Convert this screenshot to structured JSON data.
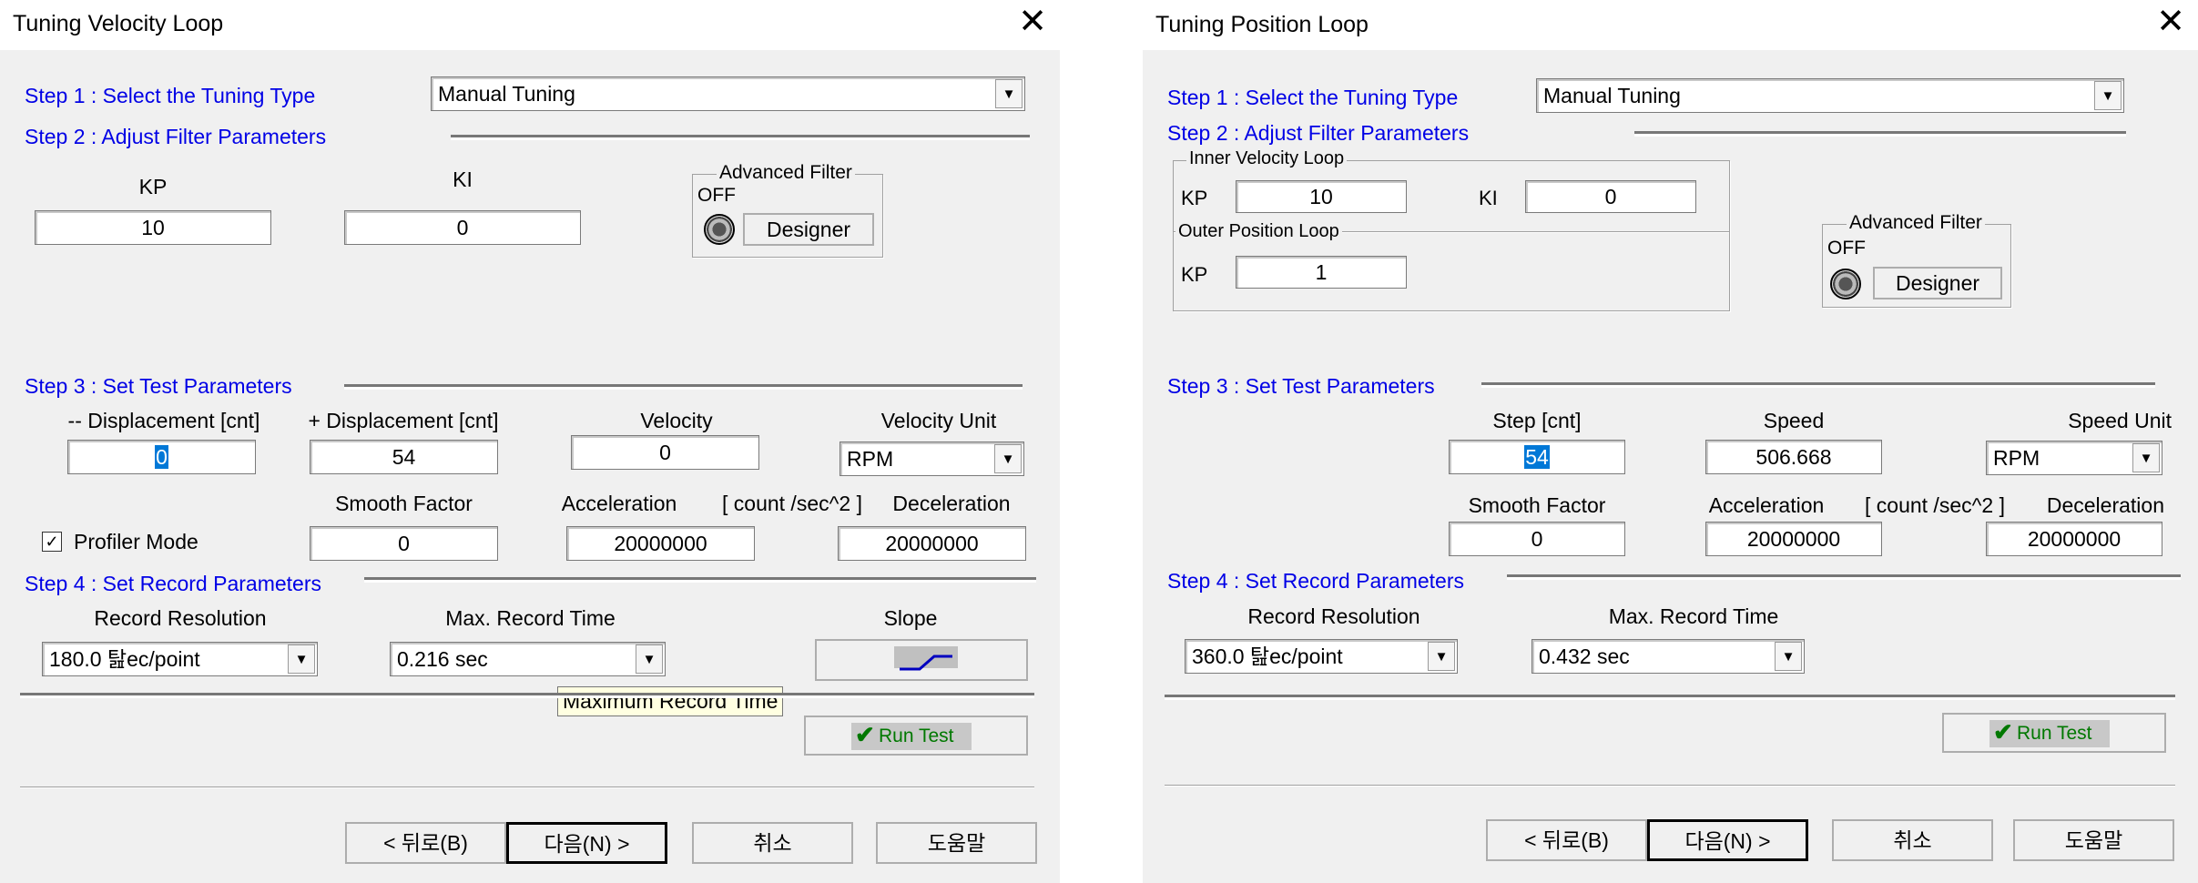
{
  "velocity_dialog": {
    "title": "Tuning Velocity Loop",
    "step1": "Step 1 : Select the  Tuning Type",
    "tuning_type": "Manual Tuning",
    "step2": "Step 2 :  Adjust Filter Parameters",
    "kp_label": "KP",
    "kp_value": "10",
    "ki_label": "KI",
    "ki_value": "0",
    "adv_filter_title": "Advanced Filter",
    "adv_filter_state": "OFF",
    "designer_label": "Designer",
    "step3": "Step 3 : Set Test  Parameters",
    "neg_disp_label": "-- Displacement [cnt]",
    "neg_disp_value": "0",
    "pos_disp_label": "+ Displacement [cnt]",
    "pos_disp_value": "54",
    "velocity_label": "Velocity",
    "velocity_value": "0",
    "velocity_unit_label": "Velocity Unit",
    "velocity_unit_value": "RPM",
    "smooth_label": "Smooth Factor",
    "smooth_value": "0",
    "accel_label": "Acceleration",
    "units_label": "[ count /sec^2 ]",
    "decel_label": "Deceleration",
    "accel_value": "20000000",
    "decel_value": "20000000",
    "profiler_label": "Profiler Mode",
    "profiler_checked": "✓",
    "step4": "Step 4 : Set Record Parameters",
    "record_res_label": "Record Resolution",
    "record_res_value": "180.0 탎ec/point",
    "max_time_label": "Max. Record Time",
    "max_time_value": "0.216 sec",
    "slope_label": "Slope",
    "tooltip": "Maximum Record Time",
    "run_test": "Run Test",
    "back": "< 뒤로(B)",
    "next": "다음(N) >",
    "cancel": "취소",
    "help": "도움말"
  },
  "position_dialog": {
    "title": "Tuning Position Loop",
    "step1": "Step 1 : Select the  Tuning Type",
    "tuning_type": "Manual Tuning",
    "step2": "Step 2 :  Adjust Filter Parameters",
    "inner_group": "Inner Velocity Loop",
    "inner_kp_label": "KP",
    "inner_kp_value": "10",
    "inner_ki_label": "KI",
    "inner_ki_value": "0",
    "outer_group": "Outer Position Loop",
    "outer_kp_label": "KP",
    "outer_kp_value": "1",
    "adv_filter_title": "Advanced Filter",
    "adv_filter_state": "OFF",
    "designer_label": "Designer",
    "step3": "Step 3 : Set Test  Parameters",
    "step_label": "Step [cnt]",
    "step_value": "54",
    "speed_label": "Speed",
    "speed_value": "506.668",
    "speed_unit_label": "Speed Unit",
    "speed_unit_value": "RPM",
    "smooth_label": "Smooth Factor",
    "smooth_value": "0",
    "accel_label": "Acceleration",
    "units_label": "[ count /sec^2 ]",
    "decel_label": "Deceleration",
    "accel_value": "20000000",
    "decel_value": "20000000",
    "step4": "Step 4 : Set Record Parameters",
    "record_res_label": "Record Resolution",
    "record_res_value": "360.0 탎ec/point",
    "max_time_label": "Max. Record Time",
    "max_time_value": "0.432 sec",
    "run_test": "Run Test",
    "back": "< 뒤로(B)",
    "next": "다음(N) >",
    "cancel": "취소",
    "help": "도움말"
  },
  "icons": {
    "dropdown": "chevron-down-icon",
    "close": "close-icon",
    "run": "checkmark-icon",
    "led": "led-indicator-icon",
    "slope": "slope-icon"
  },
  "colors": {
    "step_text": "#0000e6",
    "run_text": "#007800",
    "dialog_bg": "#f0f0f0",
    "tooltip_bg": "#ffffe1",
    "selection": "#0078d7"
  }
}
